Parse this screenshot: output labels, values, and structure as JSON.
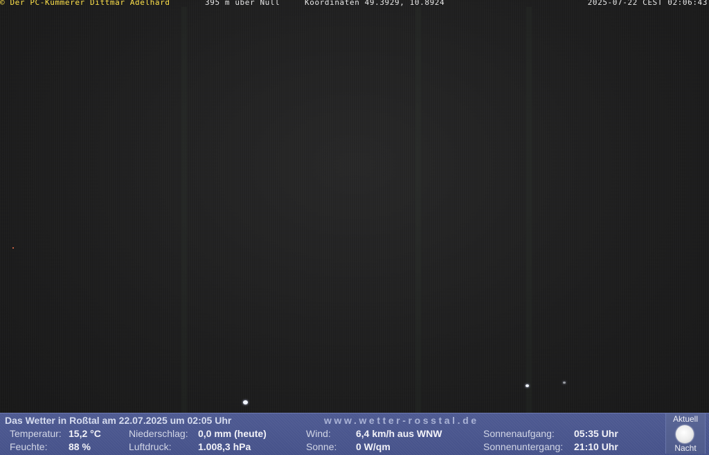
{
  "overlay": {
    "credit": "© Der PC-Kümmerer Dittmar Adelhard",
    "altitude": "395 m über Null",
    "coordinates": "Koordinaten 49.3929, 10.8924",
    "timestamp": "2025-07-22 CEST 02:06:43"
  },
  "weather": {
    "headline": "Das Wetter in Roßtal am 22.07.2025 um 02:05 Uhr",
    "website": "www.wetter-rosstal.de",
    "temperature": {
      "label": "Temperatur:",
      "value": "15,2 °C"
    },
    "humidity": {
      "label": "Feuchte:",
      "value": "88 %"
    },
    "precipitation": {
      "label": "Niederschlag:",
      "value": "0,0 mm (heute)"
    },
    "pressure": {
      "label": "Luftdruck:",
      "value": "1.008,3 hPa"
    },
    "wind": {
      "label": "Wind:",
      "value": "6,4 km/h aus WNW"
    },
    "sun": {
      "label": "Sonne:",
      "value": "0 W/qm"
    },
    "sunrise": {
      "label": "Sonnenaufgang:",
      "value": "05:35 Uhr"
    },
    "sunset": {
      "label": "Sonnenuntergang:",
      "value": "21:10 Uhr"
    }
  },
  "moon": {
    "top_label": "Aktuell",
    "bottom_label": "Nacht",
    "icon": "full-moon-icon"
  },
  "colors": {
    "credit": "#ffe24a",
    "panel": "#4a568e",
    "night_sky": "#1c1c1c"
  }
}
